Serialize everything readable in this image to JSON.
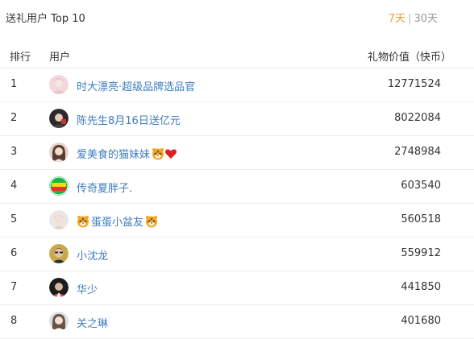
{
  "header": {
    "title": "送礼用户 Top 10",
    "range_active": "7天",
    "range_separator": "|",
    "range_inactive": "30天"
  },
  "table": {
    "columns": {
      "rank": "排行",
      "user": "用户",
      "value": "礼物价值（快币）"
    },
    "rows": [
      {
        "rank": "1",
        "name": "时大漂亮·超级品牌选品官",
        "value": "12771524"
      },
      {
        "rank": "2",
        "name": "陈先生8月16日送亿元",
        "value": "8022084"
      },
      {
        "rank": "3",
        "name": "爱美食的猫妹妹",
        "value": "2748984"
      },
      {
        "rank": "4",
        "name": "传奇夏胖子.",
        "value": "603540"
      },
      {
        "rank": "5",
        "name": "蛋蛋小盆友",
        "value": "560518"
      },
      {
        "rank": "6",
        "name": "小沈龙",
        "value": "559912"
      },
      {
        "rank": "7",
        "name": "华少",
        "value": "441850"
      },
      {
        "rank": "8",
        "name": "关之琳",
        "value": "401680"
      }
    ]
  },
  "colors": {
    "accent": "#f39a2b",
    "link": "#3e7cc0",
    "text": "#333333",
    "muted": "#999999",
    "divider": "#eeeeee"
  },
  "icons": {
    "tiger": "tiger-face-icon",
    "heart": "red-heart-icon",
    "avatar": "user-avatar"
  }
}
